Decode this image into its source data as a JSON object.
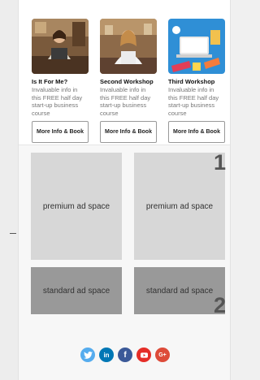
{
  "workshops": [
    {
      "title": "Is It For Me?",
      "desc": "Invaluable info in this FREE half day start-up business course",
      "button": "More Info & Book"
    },
    {
      "title": "Second Workshop",
      "desc": "Invaluable info in this FREE half day start-up business course",
      "button": "More Info & Book"
    },
    {
      "title": "Third Workshop",
      "desc": "Invaluable info in this FREE half day start-up business course",
      "button": "More Info & Book"
    }
  ],
  "ads": {
    "premium_left": "premium ad space",
    "premium_right": "premium ad space",
    "standard_left": "standard ad space",
    "standard_right": "standard ad space",
    "marker_1": "1",
    "marker_2": "2"
  },
  "social": {
    "twitter": {
      "icon": "twitter-icon",
      "color": "#55acee"
    },
    "linkedin": {
      "icon": "linkedin-icon",
      "color": "#0077b5",
      "glyph": "in"
    },
    "facebook": {
      "icon": "facebook-icon",
      "color": "#3b5998",
      "glyph": "f"
    },
    "youtube": {
      "icon": "youtube-icon",
      "color": "#e52d27"
    },
    "googleplus": {
      "icon": "google-plus-icon",
      "color": "#dd4b39",
      "glyph": "G+"
    }
  }
}
